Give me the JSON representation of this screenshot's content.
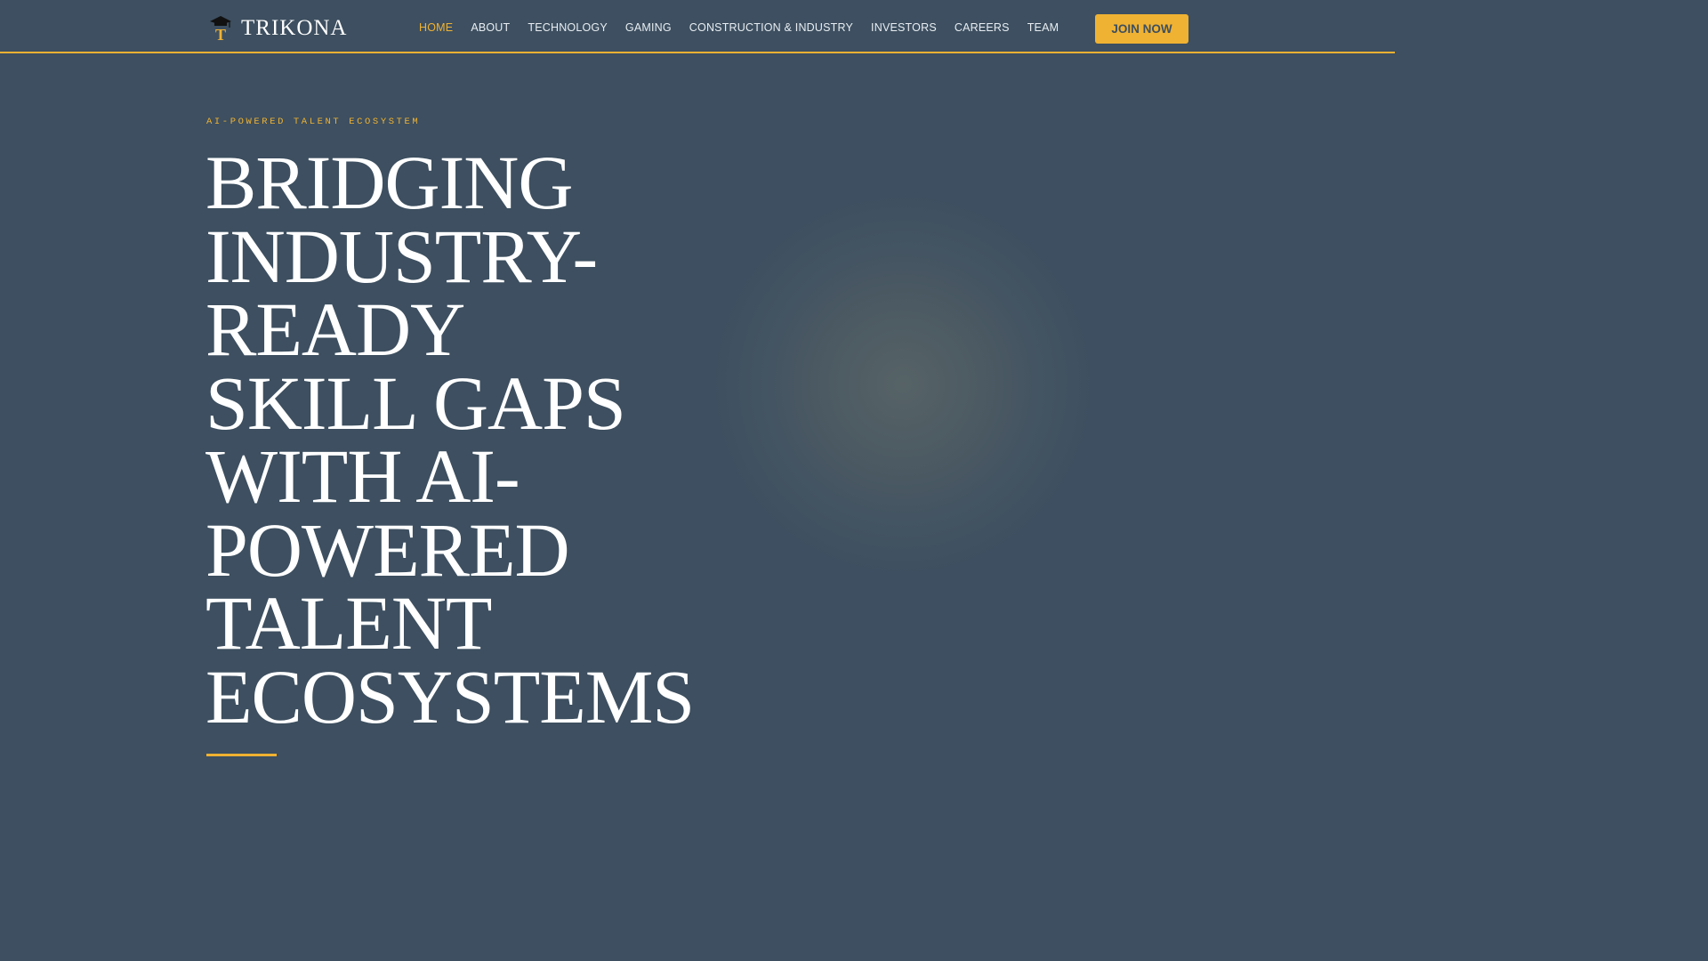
{
  "colors": {
    "background": "#3d4f60",
    "accent": "#f0b232",
    "text": "#ffffff"
  },
  "header": {
    "logo_icon": "graduation-cap-T-icon",
    "brand": "TRIKONA",
    "nav": [
      {
        "label": "HOME",
        "active": true
      },
      {
        "label": "ABOUT",
        "active": false
      },
      {
        "label": "TECHNOLOGY",
        "active": false
      },
      {
        "label": "GAMING",
        "active": false
      },
      {
        "label": "CONSTRUCTION & INDUSTRY",
        "active": false
      },
      {
        "label": "INVESTORS",
        "active": false
      },
      {
        "label": "CAREERS",
        "active": false
      },
      {
        "label": "TEAM",
        "active": false
      }
    ],
    "cta_label": "JOIN NOW"
  },
  "hero": {
    "eyebrow": "AI-POWERED TALENT ECOSYSTEM",
    "headline_lines": [
      "BRIDGING",
      "INDUSTRY-",
      "READY",
      "SKILL GAPS",
      "WITH AI-",
      "POWERED",
      "TALENT",
      "ECOSYSTEMS"
    ]
  }
}
